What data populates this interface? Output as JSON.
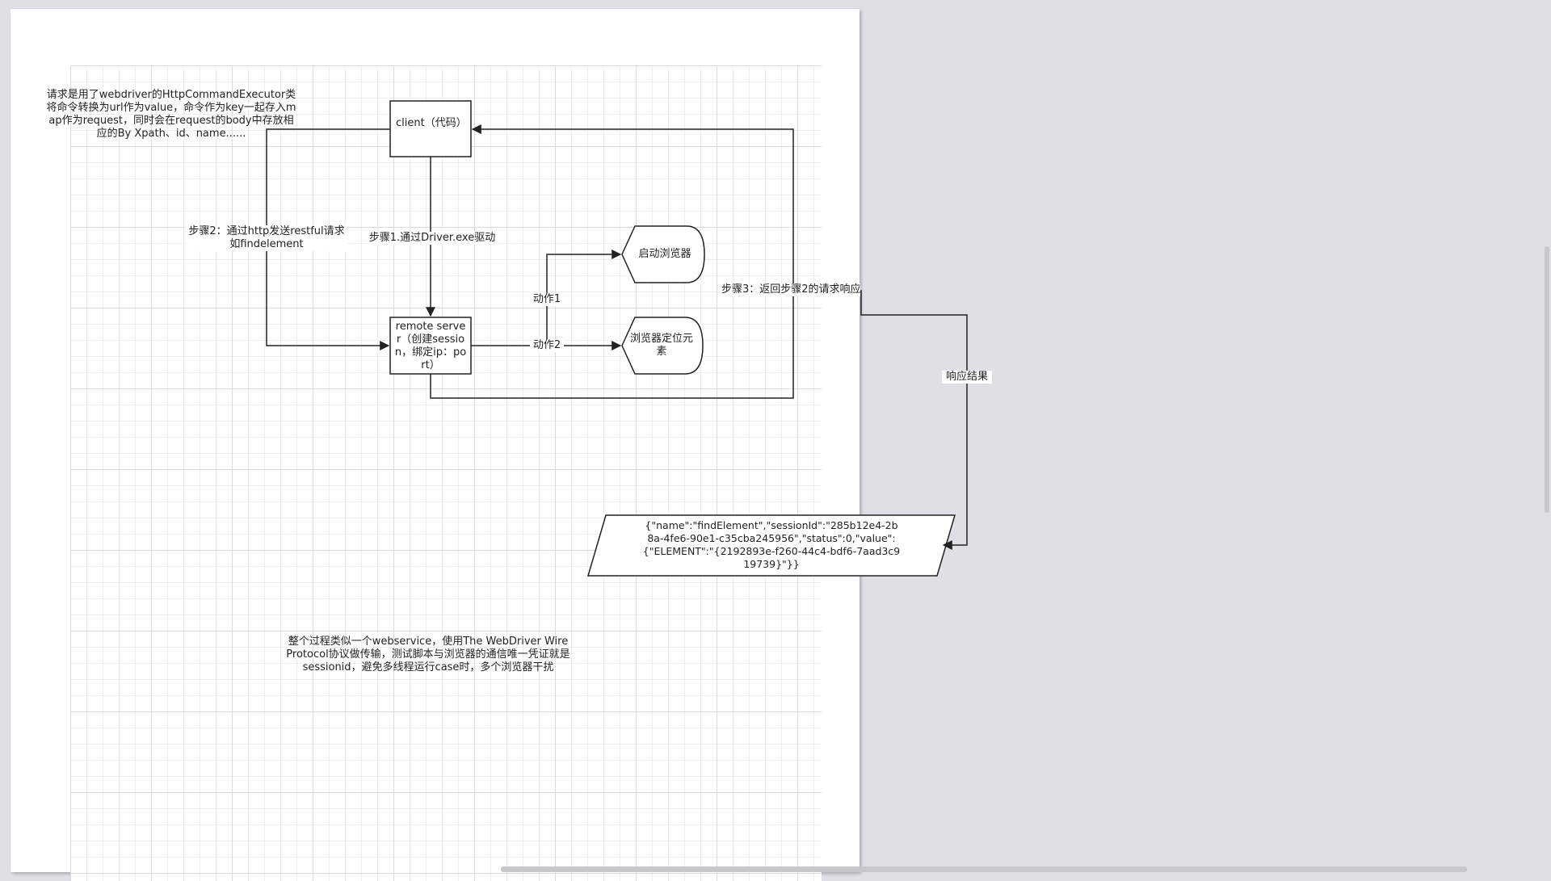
{
  "diagram": {
    "top_note": "请求是用了webdriver的HttpCommandExecutor类将命令转换为url作为value，命令作为key一起存入map作为request，同时会在request的body中存放相应的By Xpath、id、name......",
    "client_label": "client（代码）",
    "remote_server_label": "remote server（创建session，绑定ip：port）",
    "launch_browser_label": "启动浏览器",
    "locate_element_label": "浏览器定位元素",
    "step1_label": "步骤1.通过Driver.exe驱动",
    "step2_label": "步骤2：通过http发送restful请求如findelement",
    "step3_label": "步骤3：返回步骤2的请求响应",
    "action1_label": "动作1",
    "action2_label": "动作2",
    "response_result_label": "响应结果",
    "response_json": "{\"name\":\"findElement\",\"sessionId\":\"285b12e4-2b8a-4fe6-90e1-c35cba245956\",\"status\":0,\"value\":{\"ELEMENT\":\"{2192893e-f260-44c4-bdf6-7aad3c919739}\"}}",
    "bottom_note": "整个过程类似一个webservice，使用The WebDriver Wire Protocol协议做传输，测试脚本与浏览器的通信唯一凭证就是sessionid，避免多线程运行case时，多个浏览器干扰"
  },
  "colors": {
    "canvas_bg": "#dfe0e4",
    "page_bg": "#ffffff",
    "stroke": "#222222"
  }
}
